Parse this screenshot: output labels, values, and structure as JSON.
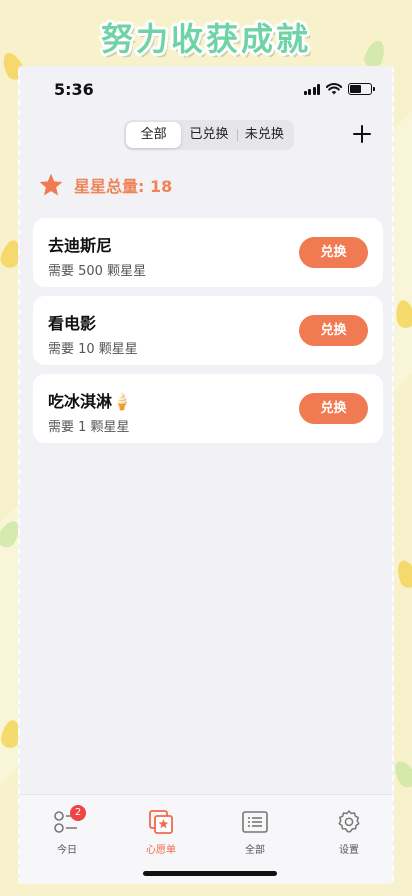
{
  "banner": {
    "title": "努力收获成就"
  },
  "status_bar": {
    "time": "5:36"
  },
  "filter_tabs": [
    {
      "label": "全部",
      "active": true
    },
    {
      "label": "已兑换",
      "active": false
    },
    {
      "label": "未兑换",
      "active": false
    }
  ],
  "add_button": {
    "icon": "plus-icon"
  },
  "summary": {
    "icon": "star-icon",
    "text": "星星总量: 18"
  },
  "wishes": [
    {
      "title": "去迪斯尼",
      "subtitle": "需要 500 颗星星",
      "button": "兑换"
    },
    {
      "title": "看电影",
      "subtitle": "需要 10 颗星星",
      "button": "兑换"
    },
    {
      "title": "吃冰淇淋🍦",
      "subtitle": "需要 1 颗星星",
      "button": "兑换"
    }
  ],
  "tab_bar": [
    {
      "label": "今日",
      "icon": "list-toggle-icon",
      "badge": "2",
      "active": false
    },
    {
      "label": "心愿单",
      "icon": "wishlist-star-icon",
      "active": true
    },
    {
      "label": "全部",
      "icon": "document-list-icon",
      "active": false
    },
    {
      "label": "设置",
      "icon": "gear-icon",
      "active": false
    }
  ],
  "colors": {
    "accent": "#f07a51",
    "summary_text": "#ef8457",
    "banner_text": "#6fd3a6",
    "badge": "#f04444",
    "background": "#f2f2f6"
  }
}
